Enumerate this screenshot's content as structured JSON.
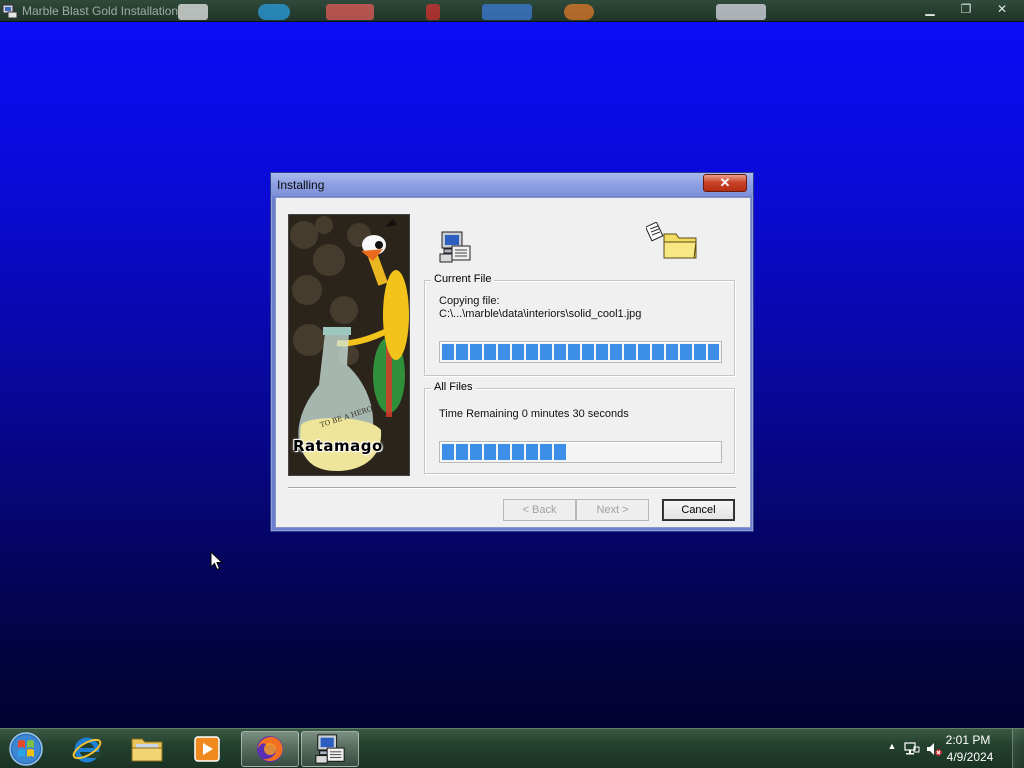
{
  "outer_window": {
    "title": "Marble Blast Gold Installation",
    "minimize": "▁",
    "restore": "❐",
    "close": "✕"
  },
  "dialog": {
    "title": "Installing",
    "close_glyph": "✕",
    "splash_label": "Ratamago",
    "splash_badge": "TO BE A HERO",
    "current_file": {
      "legend": "Current File",
      "line1": "Copying file:",
      "line2": "C:\\...\\marble\\data\\interiors\\solid_cool1.jpg",
      "progress": 1.0
    },
    "all_files": {
      "legend": "All Files",
      "status": "Time Remaining 0 minutes 30 seconds",
      "progress": 0.45
    },
    "buttons": {
      "back": "< Back",
      "next": "Next >",
      "cancel": "Cancel"
    }
  },
  "taskbar": {
    "items": [
      {
        "name": "internet-explorer",
        "icon": "ie-icon"
      },
      {
        "name": "file-explorer",
        "icon": "folder-icon"
      },
      {
        "name": "media-player",
        "icon": "media-player-icon"
      },
      {
        "name": "firefox",
        "icon": "firefox-icon"
      },
      {
        "name": "setup",
        "icon": "setup-icon",
        "active": true
      }
    ],
    "tray": {
      "time": "2:01 PM",
      "date": "4/9/2024",
      "show_hidden": "▲"
    }
  },
  "colors": {
    "progress": "#3c8ee6",
    "desktop_top": "#0d0dfb",
    "desktop_bottom": "#02022a",
    "taskbar": "#24402e"
  }
}
